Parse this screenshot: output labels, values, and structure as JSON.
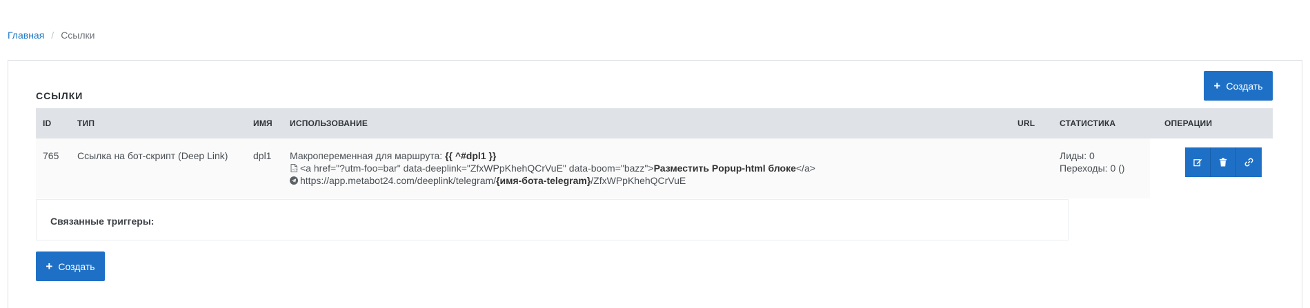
{
  "breadcrumb": {
    "home": "Главная",
    "separator": "/",
    "current": "Ссылки"
  },
  "panel": {
    "title": "ССЫЛКИ",
    "create_label": "Создать"
  },
  "table": {
    "headers": {
      "id": "ID",
      "type": "ТИП",
      "name": "ИМЯ",
      "usage": "ИСПОЛЬЗОВАНИЕ",
      "url": "URL",
      "stats": "СТАТИСТИКА",
      "ops": "ОПЕРАЦИИ"
    },
    "rows": [
      {
        "id": "765",
        "type": "Ссылка на бот-скрипт (Deep Link)",
        "name": "dpl1",
        "usage": {
          "macro_label": "Макропеременная для маршрута:",
          "macro_value": "{{ ^#dpl1 }}",
          "html_prefix": "<a href=\"?utm-foo=bar\" data-deeplink=\"ZfxWPpKhehQCrVuE\" data-boom=\"bazz\">",
          "html_bold": "Разместить Popup-html блоке",
          "html_suffix": "</a>",
          "link_prefix": "https://app.metabot24.com/deeplink/telegram/",
          "link_bold": "{имя-бота-telegram}",
          "link_suffix": "/ZfxWPpKhehQCrVuE"
        },
        "url": "",
        "stats": {
          "leads": "Лиды: 0",
          "transitions": "Переходы: 0 ()"
        },
        "ops_icons": [
          "edit-icon",
          "trash-icon",
          "link-icon"
        ]
      }
    ]
  },
  "related": {
    "label": "Связанные триггеры:"
  },
  "bottom": {
    "create_label": "Создать"
  },
  "colors": {
    "primary": "#1e70c6",
    "link": "#1e78c8",
    "header_bg": "#dfe3e8"
  }
}
